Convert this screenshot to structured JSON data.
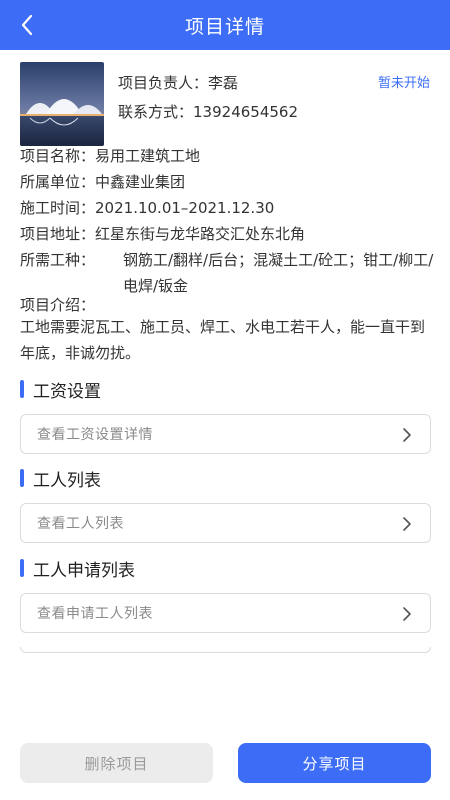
{
  "header": {
    "title": "项目详情"
  },
  "summary": {
    "manager_label": "项目负责人：",
    "manager_name": "李磊",
    "contact_label": "联系方式：",
    "contact_phone": "13924654562",
    "status": "暂未开始"
  },
  "details": {
    "name_label": "项目名称：",
    "name_value": "易用工建筑工地",
    "unit_label": "所属单位：",
    "unit_value": "中鑫建业集团",
    "time_label": "施工时间：",
    "time_value": "2021.10.01–2021.12.30",
    "address_label": "项目地址：",
    "address_value": "红星东街与龙华路交汇处东北角",
    "trades_label": "所需工种：",
    "trades_value": "钢筋工/翻样/后台；混凝土工/砼工；钳工/柳工/电焊/钣金",
    "intro_label": "项目介绍：",
    "intro_value": "工地需要泥瓦工、施工员、焊工、水电工若干人，能一直干到年底，非诚勿扰。"
  },
  "sections": {
    "wage": {
      "title": "工资设置",
      "link": "查看工资设置详情"
    },
    "workers": {
      "title": "工人列表",
      "link": "查看工人列表"
    },
    "applications": {
      "title": "工人申请列表",
      "link": "查看申请工人列表"
    }
  },
  "actions": {
    "delete": "删除项目",
    "share": "分享项目"
  },
  "colors": {
    "primary": "#3d6df6",
    "status": "#3d6df6",
    "disabled_bg": "#ececec"
  },
  "icons": {
    "back": "back-arrow-icon",
    "chevron": "chevron-right-icon"
  }
}
